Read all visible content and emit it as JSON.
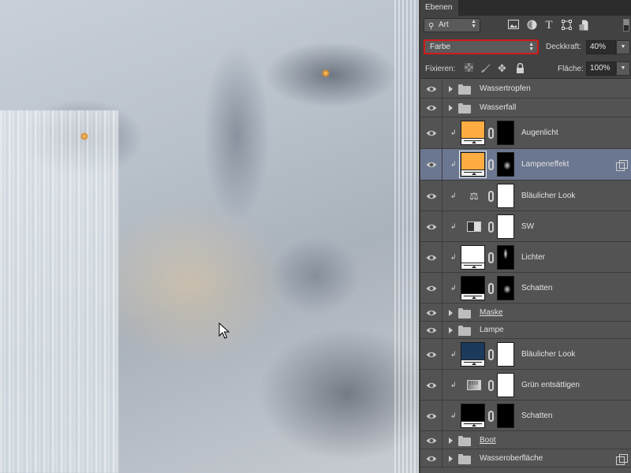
{
  "canvas": {
    "description": "Photo composite: close-up of man's face with water effects and glowing orange eyes",
    "eye_glow_color": "#ffb347"
  },
  "panel": {
    "tab_label": "Ebenen",
    "filter": {
      "kind_label": "Art",
      "icons": [
        "image-filter-icon",
        "adjustment-filter-icon",
        "type-filter-icon",
        "shape-filter-icon",
        "smart-object-filter-icon"
      ]
    },
    "blend_mode": "Farbe",
    "opacity_label": "Deckkraft:",
    "opacity_value": "40%",
    "lock_label": "Fixieren:",
    "fill_label": "Fläche:",
    "fill_value": "100%",
    "highlight_color": "#d21a1a"
  },
  "layers": [
    {
      "name": "Wassertropfen",
      "type": "group",
      "underlined": false
    },
    {
      "name": "Wasserfall",
      "type": "group",
      "underlined": false
    },
    {
      "name": "Augenlicht",
      "type": "fill",
      "thumb_color": "#ffad42",
      "mask": "black"
    },
    {
      "name": "Lampeneffekt",
      "type": "fill",
      "thumb_color": "#ffad42",
      "mask": "black-glow",
      "selected": true,
      "smart": true
    },
    {
      "name": "Bläulicher Look",
      "type": "adjust",
      "icon": "balance-icon",
      "mask": "white"
    },
    {
      "name": "SW",
      "type": "adjust",
      "icon": "black-white-icon",
      "mask": "white"
    },
    {
      "name": "Lichter",
      "type": "fill",
      "thumb_color": "#ffffff",
      "mask": "black-streak"
    },
    {
      "name": "Schatten",
      "type": "fill",
      "thumb_color": "#000000",
      "mask": "black-glow"
    },
    {
      "name": "Maske",
      "type": "group",
      "underlined": true
    },
    {
      "name": "Lampe",
      "type": "group",
      "underlined": false
    },
    {
      "name": "Bläulicher Look",
      "type": "fill",
      "thumb_color": "#1c3a5c",
      "mask": "white"
    },
    {
      "name": "Grün entsättigen",
      "type": "adjust",
      "icon": "hue-saturation-icon",
      "mask": "white"
    },
    {
      "name": "Schatten",
      "type": "fill",
      "thumb_color": "#000000",
      "mask": "black"
    },
    {
      "name": "Boot",
      "type": "group",
      "underlined": true
    },
    {
      "name": "Wasseroberfläche",
      "type": "group",
      "underlined": false,
      "smart": true
    }
  ]
}
